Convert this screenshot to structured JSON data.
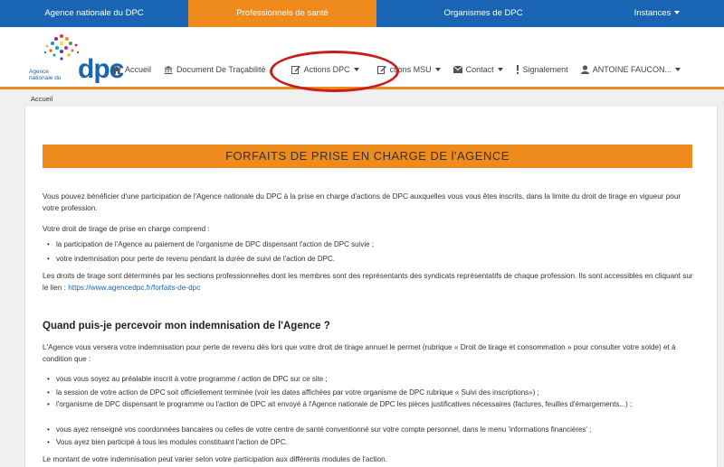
{
  "topbar": {
    "items": [
      {
        "label": "Agence nationale du DPC"
      },
      {
        "label": "Professionnels de santé"
      },
      {
        "label": "Organismes de DPC"
      },
      {
        "label": "Instances"
      }
    ]
  },
  "logo": {
    "small_text": "Agence nationale du",
    "big_text": "dpc"
  },
  "nav": {
    "accueil": "Accueil",
    "document": "Document De Traçabilité",
    "actions": "Actions DPC",
    "actions_msu": "ctions MSU",
    "contact": "Contact",
    "signalement": "Signalement",
    "user": "ANTOINE FAUCON..."
  },
  "breadcrumb": "Accueil",
  "banner": "FORFAITS DE PRISE EN CHARGE DE l'AGENCE",
  "intro": "Vous pouvez bénéficier d'une participation de l'Agence nationale du DPC à la prise en charge d'actions de DPC auxquelles vous vous êtes inscrits, dans la limite du droit de tirage en vigueur pour votre profession.",
  "droit_intro": "Votre droit de tirage de prise en charge comprend :",
  "droit_items": [
    "la participation de l'Agence au paiement de l'organisme de DPC dispensant l'action de DPC suivie ;",
    "votre indemnisation pour perte de revenu pendant la durée de suivi de l'action de DPC."
  ],
  "droits_text": "Les droits de tirage sont déterminés par les sections professionnelles dont les membres sont des représentants des syndicats représentatifs de chaque profession. Ils sont accessibles en cliquant sur le lien :",
  "droits_link": "https://www.agencedpc.fr/forfaits-de-dpc",
  "heading": "Quand puis-je percevoir mon indemnisation de l'Agence ?",
  "indem_intro": "L'Agence vous versera votre indemnisation pour perte de revenu dès lors que votre droit de tirage annuel le permet (rubrique « Droit de tirage et consommation » pour consulter votre solde) et à condition que :",
  "conditions": [
    "vous vous soyez au préalable inscrit à votre programme / action de DPC sur ce site ;",
    "la session de votre action de DPC soit officiellement terminée (voir les dates affichées par votre organisme de DPC rubrique « Suivi des inscriptions») ;",
    "l'organisme de DPC dispensant le programme ou l'action de DPC ait envoyé à l'Agence nationale de DPC les pièces justificatives nécessaires (factures, feuilles d'émargements...) ;",
    "vous ayez renseigné vos coordonnées bancaires ou celles de votre centre de santé conventionné sur votre compte personnel, dans le menu 'informations financières' ;",
    "Vous ayez bien participé à tous les modules constituant l'action de DPC."
  ],
  "footer_text": "Le montant de votre indemnisation peut varier selon votre participation aux différents modules de l'action.",
  "colors": {
    "blue": "#1a64b4",
    "orange": "#ef8a1c",
    "red_circle": "#c81e1e"
  }
}
